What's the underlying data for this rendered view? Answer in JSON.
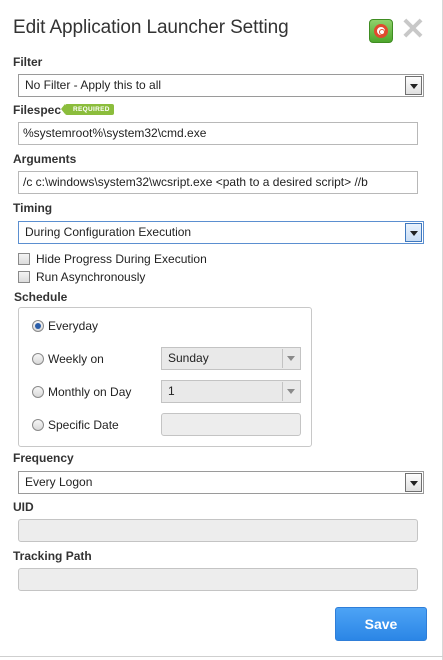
{
  "dialog": {
    "title": "Edit Application Launcher Setting",
    "help_icon": "lifebuoy-icon",
    "close_icon": "close-icon",
    "close_glyph": "✕"
  },
  "filter": {
    "label": "Filter",
    "selected": "No Filter - Apply this to all"
  },
  "filespec": {
    "label": "Filespec",
    "badge": "REQUIRED",
    "value": "%systemroot%\\system32\\cmd.exe"
  },
  "arguments": {
    "label": "Arguments",
    "value": "/c c:\\windows\\system32\\wcsript.exe <path to a desired script> //b"
  },
  "timing": {
    "label": "Timing",
    "selected": "During Configuration Execution",
    "options": {
      "hide_progress": "Hide Progress During Execution",
      "run_async": "Run Asynchronously"
    }
  },
  "schedule": {
    "label": "Schedule",
    "everyday": "Everyday",
    "weekly": "Weekly on",
    "weekly_value": "Sunday",
    "monthly": "Monthly on Day",
    "monthly_value": "1",
    "specific": "Specific Date",
    "specific_value": "",
    "selected": "everyday"
  },
  "frequency": {
    "label": "Frequency",
    "selected": "Every Logon"
  },
  "uid": {
    "label": "UID",
    "value": ""
  },
  "tracking_path": {
    "label": "Tracking Path",
    "value": ""
  },
  "actions": {
    "save_label": "Save"
  },
  "colors": {
    "accent": "#2b86e6",
    "required_badge": "#8bbd3c"
  }
}
